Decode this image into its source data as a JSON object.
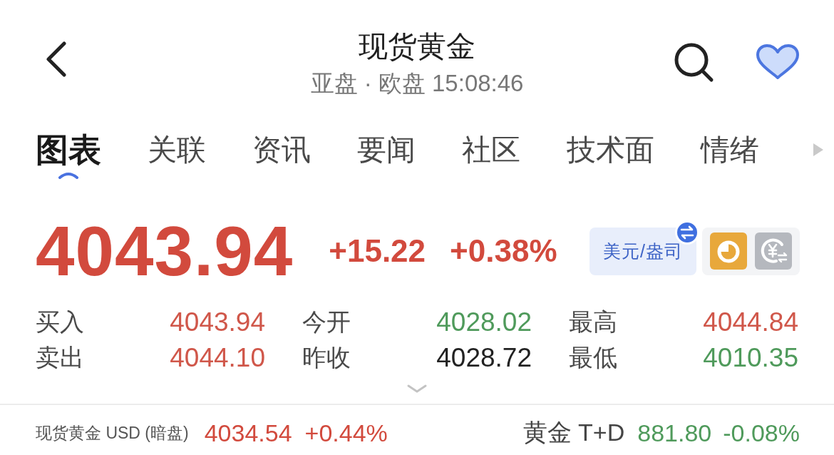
{
  "header": {
    "title": "现货黄金",
    "subtitle": "亚盘 · 欧盘 15:08:46",
    "favorite": true
  },
  "tabs": [
    {
      "label": "图表",
      "selected": true
    },
    {
      "label": "关联",
      "selected": false
    },
    {
      "label": "资讯",
      "selected": false
    },
    {
      "label": "要闻",
      "selected": false
    },
    {
      "label": "社区",
      "selected": false
    },
    {
      "label": "技术面",
      "selected": false
    },
    {
      "label": "情绪",
      "selected": false
    }
  ],
  "quote": {
    "price": "4043.94",
    "change": "+15.22",
    "change_pct": "+0.38%",
    "rising": true,
    "unit": "美元/盎司"
  },
  "stats": [
    {
      "label": "买入",
      "value": "4043.94",
      "color": "#d0574a"
    },
    {
      "label": "今开",
      "value": "4028.02",
      "color": "#4f9a5b"
    },
    {
      "label": "最高",
      "value": "4044.84",
      "color": "#d0574a"
    },
    {
      "label": "卖出",
      "value": "4044.10",
      "color": "#d0574a"
    },
    {
      "label": "昨收",
      "value": "4028.72",
      "color": "#222222"
    },
    {
      "label": "最低",
      "value": "4010.35",
      "color": "#4f9a5b"
    }
  ],
  "tickers": [
    {
      "kind": "night",
      "name": "现货黄金 USD (暗盘)",
      "price": "4034.54",
      "change": "+0.44%",
      "color": "#d24a3d"
    },
    {
      "kind": "related",
      "name": "黄金 T+D",
      "price": "881.80",
      "change": "-0.08%",
      "color": "#4f9a5b"
    }
  ]
}
